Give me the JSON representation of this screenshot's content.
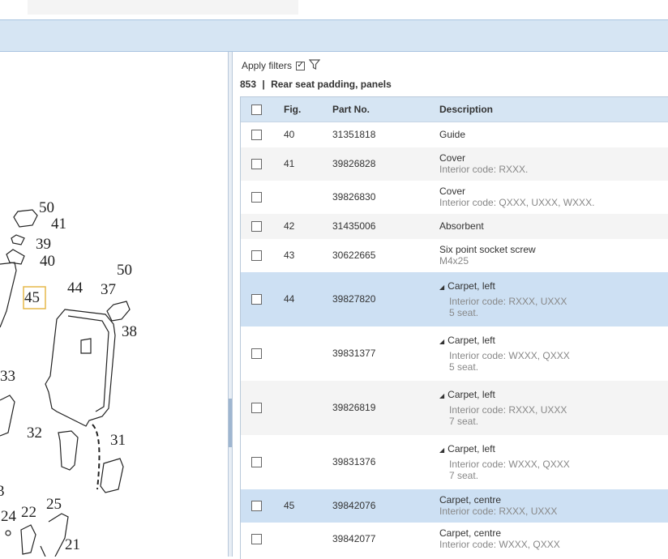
{
  "toolbar": {
    "apply_filters_label": "Apply filters",
    "apply_filters_checked": "✓"
  },
  "section": {
    "number": "853",
    "separator": "|",
    "title": "Rear seat padding, panels"
  },
  "table": {
    "headers": {
      "fig": "Fig.",
      "part_no": "Part No.",
      "description": "Description"
    },
    "rows": [
      {
        "fig": "40",
        "part_no": "31351818",
        "desc": "Guide",
        "sub1": "",
        "sub2": "",
        "tree": false
      },
      {
        "fig": "41",
        "part_no": "39826828",
        "desc": "Cover",
        "sub1": "Interior code: RXXX.",
        "sub2": "",
        "tree": false
      },
      {
        "fig": "",
        "part_no": "39826830",
        "desc": "Cover",
        "sub1": "Interior code: QXXX, UXXX, WXXX.",
        "sub2": "",
        "tree": false
      },
      {
        "fig": "42",
        "part_no": "31435006",
        "desc": "Absorbent",
        "sub1": "",
        "sub2": "",
        "tree": false
      },
      {
        "fig": "43",
        "part_no": "30622665",
        "desc": "Six point socket screw",
        "sub1": "M4x25",
        "sub2": "",
        "tree": false
      },
      {
        "fig": "44",
        "part_no": "39827820",
        "desc": "Carpet, left",
        "sub1": "Interior code: RXXX, UXXX",
        "sub2": "5 seat.",
        "tree": true
      },
      {
        "fig": "",
        "part_no": "39831377",
        "desc": "Carpet, left",
        "sub1": "Interior code: WXXX, QXXX",
        "sub2": "5 seat.",
        "tree": true
      },
      {
        "fig": "",
        "part_no": "39826819",
        "desc": "Carpet, left",
        "sub1": "Interior code: RXXX, UXXX",
        "sub2": "7 seat.",
        "tree": true
      },
      {
        "fig": "",
        "part_no": "39831376",
        "desc": "Carpet, left",
        "sub1": "Interior code: WXXX, QXXX",
        "sub2": "7 seat.",
        "tree": true
      },
      {
        "fig": "45",
        "part_no": "39842076",
        "desc": "Carpet, centre",
        "sub1": "Interior code: RXXX, UXXX",
        "sub2": "",
        "tree": false
      },
      {
        "fig": "",
        "part_no": "39842077",
        "desc": "Carpet, centre",
        "sub1": "Interior code: WXXX, QXXX",
        "sub2": "",
        "tree": false
      }
    ]
  },
  "diagram": {
    "labels": [
      "50",
      "41",
      "39",
      "40",
      "45",
      "50",
      "37",
      "44",
      "38",
      "33",
      "32",
      "31",
      "3",
      "24",
      "22",
      "25",
      "21"
    ]
  },
  "icons": {
    "filter": "filter-funnel-icon",
    "expand": "tree-collapse-triangle-icon"
  }
}
